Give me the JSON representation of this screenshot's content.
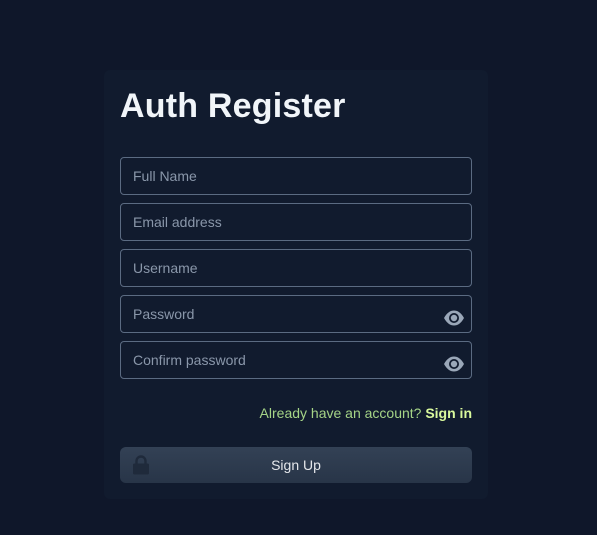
{
  "form": {
    "title": "Auth Register",
    "fields": {
      "full_name": {
        "placeholder": "Full Name",
        "value": ""
      },
      "email": {
        "placeholder": "Email address",
        "value": ""
      },
      "username": {
        "placeholder": "Username",
        "value": ""
      },
      "password": {
        "placeholder": "Password",
        "value": "",
        "icon": "eye-icon"
      },
      "confirm_password": {
        "placeholder": "Confirm password",
        "value": "",
        "icon": "eye-icon"
      }
    },
    "account_prompt": "Already have an account?",
    "signin_link": "Sign in",
    "submit_label": "Sign Up",
    "submit_icon": "lock-icon"
  },
  "colors": {
    "background": "#0f172a",
    "card": "#111b2e",
    "field_border": "#5b6b82",
    "prompt_text": "#a5d487",
    "link_text": "#d9f99d",
    "button": "#334155"
  }
}
